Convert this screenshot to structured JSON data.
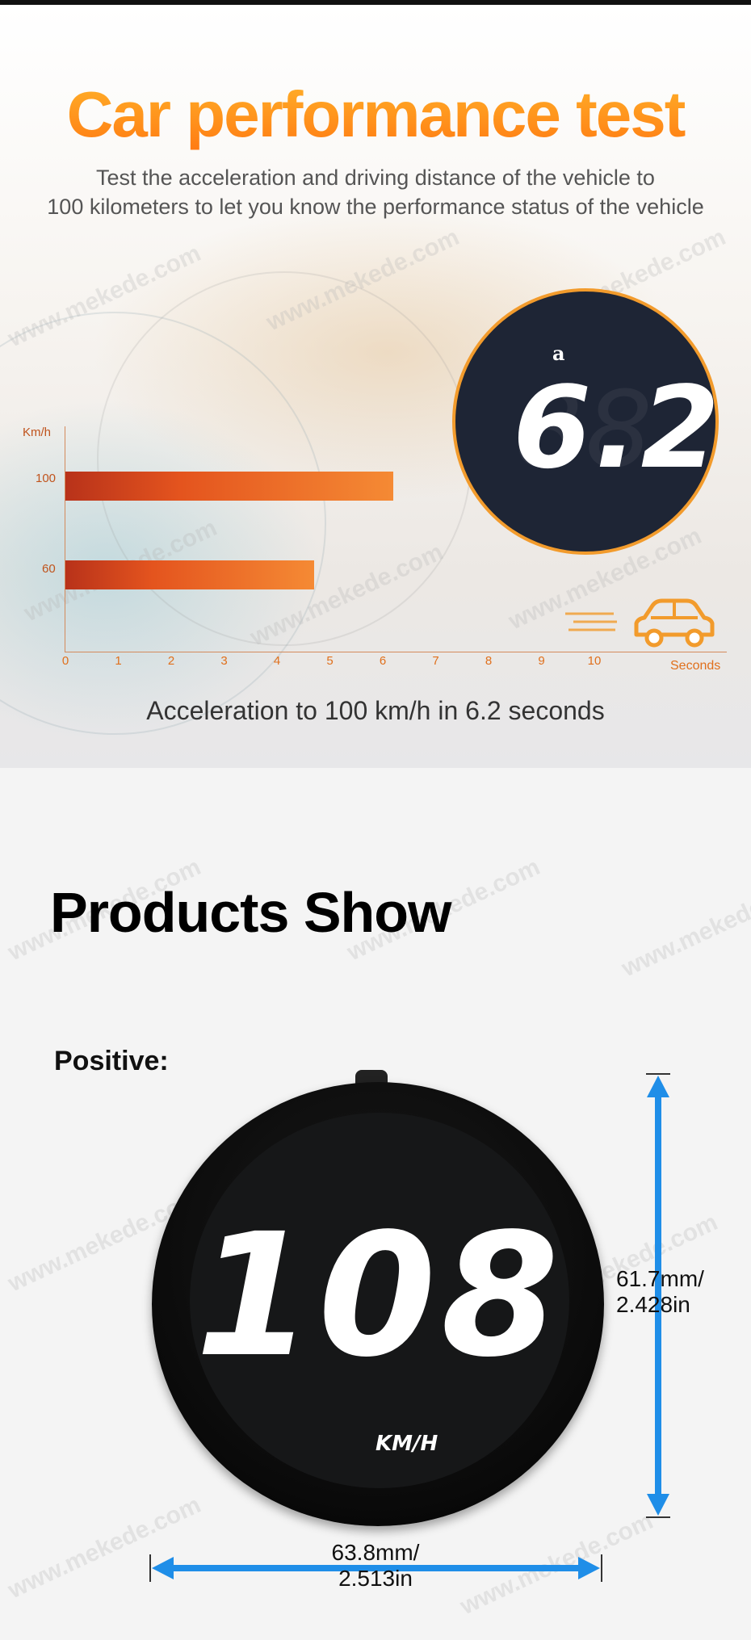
{
  "performance": {
    "title": "Car performance test",
    "subtitle_line1": "Test the acceleration and driving distance of the vehicle to",
    "subtitle_line2": "100 kilometers to let you know the performance status of the vehicle",
    "display_value": "6.2",
    "display_mark": "a",
    "caption": "Acceleration to 100 km/h in 6.2 seconds"
  },
  "chart_data": {
    "type": "bar",
    "orientation": "horizontal",
    "ylabel": "Km/h",
    "xlabel": "Seconds",
    "categories": [
      "100",
      "60"
    ],
    "values": [
      6.2,
      4.7
    ],
    "x_ticks": [
      "0",
      "1",
      "2",
      "3",
      "4",
      "5",
      "6",
      "7",
      "8",
      "9",
      "10"
    ],
    "xlim": [
      0,
      10
    ],
    "colors": {
      "bar": "#e4541e",
      "accent": "#f29b2c"
    }
  },
  "products": {
    "title": "Products Show",
    "view_label": "Positive:",
    "speed_value": "108",
    "unit_label": "KM/H",
    "height_dim": [
      "61.7mm/",
      "2.428in"
    ],
    "width_dim": [
      "63.8mm/",
      "2.513in"
    ]
  },
  "watermark": "www.mekede.com",
  "colors": {
    "orange": "#ff8a1a",
    "arrow_blue": "#1f8ee8"
  },
  "icons": {
    "car": "car-icon"
  }
}
